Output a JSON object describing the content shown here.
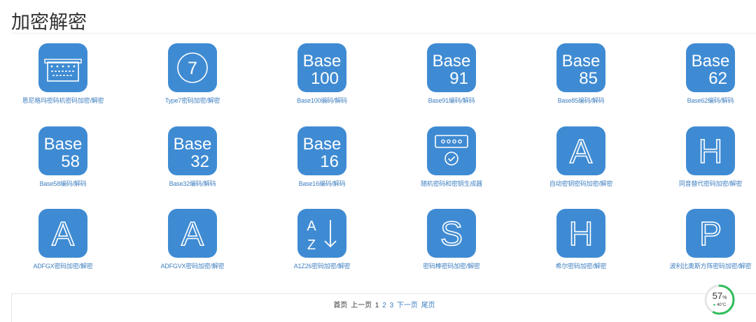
{
  "page": {
    "title": "加密解密"
  },
  "tools": [
    {
      "label": "恩尼格玛密码机密码加密/解密",
      "icon": "enigma-machine-icon",
      "glyphs": []
    },
    {
      "label": "Type7密码加密/解密",
      "icon": "circle-seven-icon",
      "glyphs": [
        "7"
      ]
    },
    {
      "label": "Base100编码/解码",
      "icon": "base100-icon",
      "glyphs": [
        "Base",
        "100"
      ]
    },
    {
      "label": "Base91编码/解码",
      "icon": "base91-icon",
      "glyphs": [
        "Base",
        "91"
      ]
    },
    {
      "label": "Base85编码/解码",
      "icon": "base85-icon",
      "glyphs": [
        "Base",
        "85"
      ]
    },
    {
      "label": "Base62编码/解码",
      "icon": "base62-icon",
      "glyphs": [
        "Base",
        "62"
      ]
    },
    {
      "label": "Base58编码/解码",
      "icon": "base58-icon",
      "glyphs": [
        "Base",
        "58"
      ]
    },
    {
      "label": "Base32编码/解码",
      "icon": "base32-icon",
      "glyphs": [
        "Base",
        "32"
      ]
    },
    {
      "label": "Base16编码/解码",
      "icon": "base16-icon",
      "glyphs": [
        "Base",
        "16"
      ]
    },
    {
      "label": "随机密码和密钥生成器",
      "icon": "password-generator-icon",
      "glyphs": []
    },
    {
      "label": "自动密钥密码加密/解密",
      "icon": "letter-a-icon",
      "glyphs": [
        "A"
      ]
    },
    {
      "label": "同音替代密码加密/解密",
      "icon": "letter-h-icon",
      "glyphs": [
        "H"
      ]
    },
    {
      "label": "ADFGX密码加密/解密",
      "icon": "letter-a-icon",
      "glyphs": [
        "A"
      ]
    },
    {
      "label": "ADFGVX密码加密/解密",
      "icon": "letter-a-icon",
      "glyphs": [
        "A"
      ]
    },
    {
      "label": "A1Z26密码加密/解密",
      "icon": "a-to-z-sort-icon",
      "glyphs": [
        "A",
        "Z"
      ]
    },
    {
      "label": "密码棒密码加密/解密",
      "icon": "letter-s-icon",
      "glyphs": [
        "S"
      ]
    },
    {
      "label": "希尔密码加密/解密",
      "icon": "letter-h-icon",
      "glyphs": [
        "H"
      ]
    },
    {
      "label": "波利比奥斯方阵密码加密/解密",
      "icon": "letter-p-icon",
      "glyphs": [
        "P"
      ]
    }
  ],
  "pagination": {
    "first": "首页",
    "prev": "上一页",
    "pages": [
      "1",
      "2",
      "3"
    ],
    "current": "1",
    "next": "下一页",
    "last": "尾页"
  },
  "widget": {
    "percent": "57",
    "percent_unit": "%",
    "temperature": "40°C",
    "percent_value": 57
  },
  "colors": {
    "tile": "#3f8bd3",
    "link": "#3f7fc0",
    "gauge": "#2ebd59"
  }
}
